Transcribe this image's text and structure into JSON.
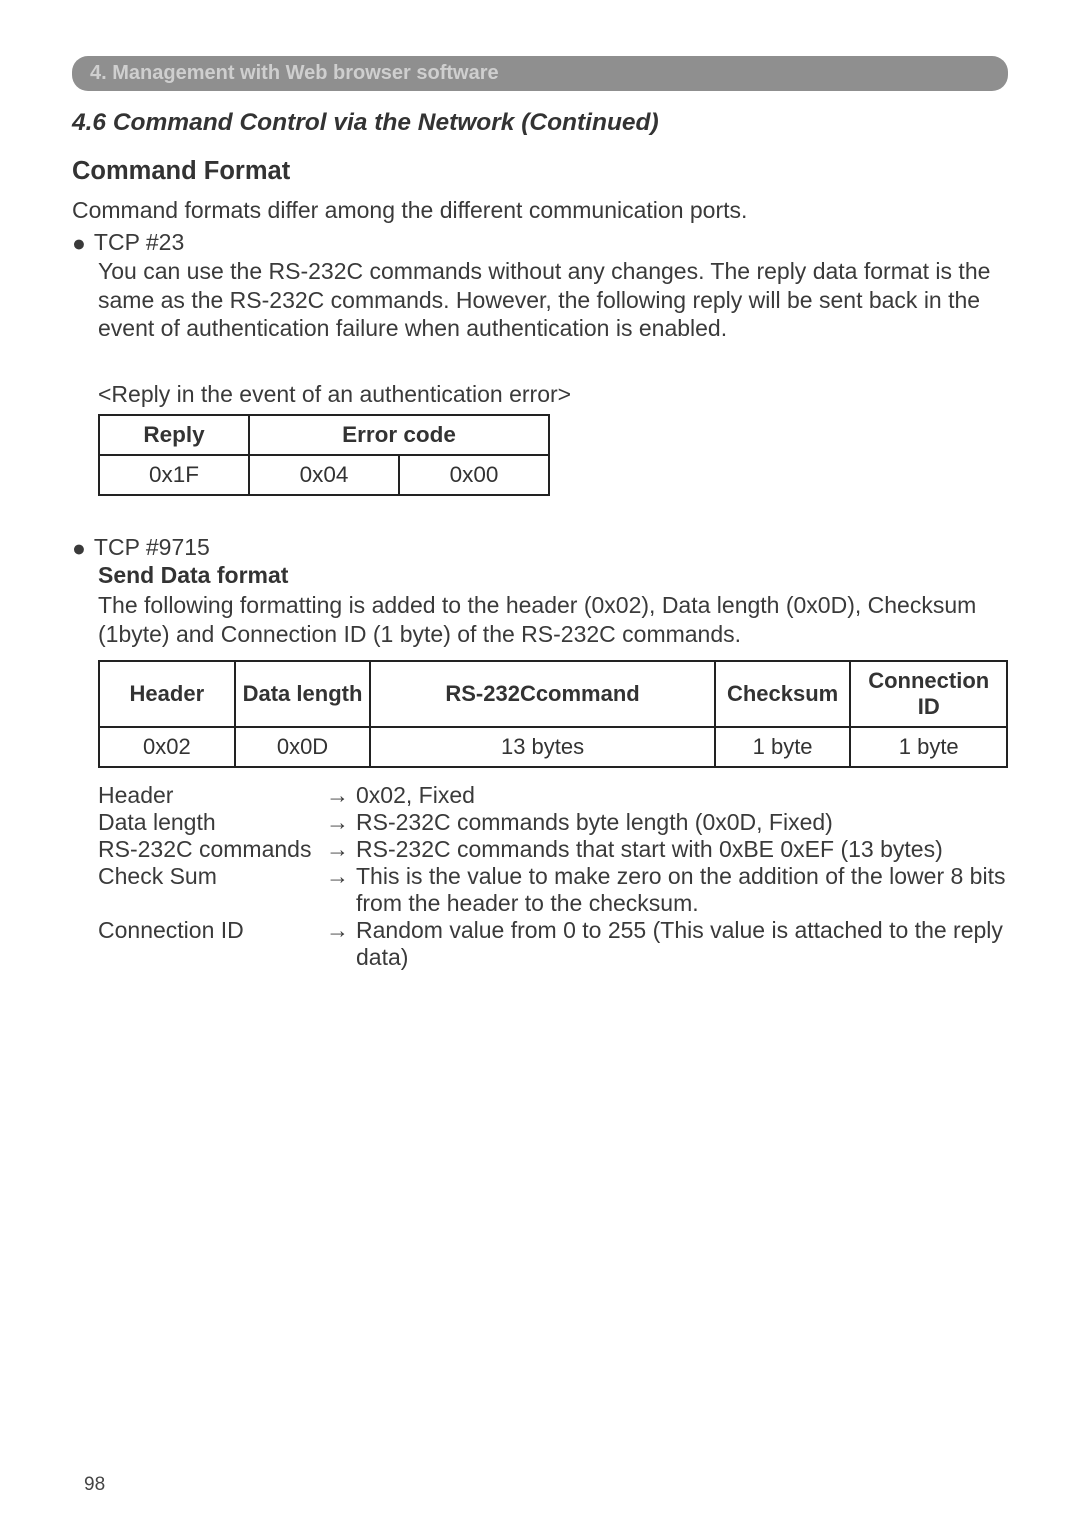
{
  "banner": "4. Management with Web browser software",
  "section_title": "4.6 Command Control via the Network (Continued)",
  "command_format_heading": "Command Format",
  "intro": "Command formats differ among the different communication ports.",
  "tcp23": {
    "label": "TCP #23",
    "p1": "You can use the RS-232C commands without any changes. The reply data format is the same as the RS-232C commands. However, the following reply will be sent back in the event of authentication failure when authentication is enabled.",
    "caption": "<Reply in the event of an authentication error>",
    "table": {
      "h1": "Reply",
      "h2": "Error code",
      "c1": "0x1F",
      "c2": "0x04",
      "c3": "0x00"
    }
  },
  "tcp9715": {
    "label": "TCP #9715",
    "send_heading": "Send Data format",
    "p1": "The following formatting is added to the header (0x02), Data length (0x0D), Checksum (1byte) and Connection ID (1 byte) of the RS-232C commands.",
    "table": {
      "h1": "Header",
      "h2": "Data length",
      "h3": "RS-232Ccommand",
      "h4": "Checksum",
      "h5": "Connection ID",
      "c1": "0x02",
      "c2": "0x0D",
      "c3": "13 bytes",
      "c4": "1 byte",
      "c5": "1 byte"
    },
    "defs": [
      {
        "term": "Header",
        "desc": "0x02, Fixed"
      },
      {
        "term": "Data length",
        "desc": "RS-232C commands byte length (0x0D, Fixed)"
      },
      {
        "term": "RS-232C commands",
        "desc": "RS-232C commands that start with 0xBE 0xEF (13 bytes)"
      },
      {
        "term": "Check Sum",
        "desc": "This is the value to make zero on the addition of the lower 8 bits from the header to the checksum."
      },
      {
        "term": "Connection ID",
        "desc": "Random value from 0 to 255 (This value is attached to the reply data)"
      }
    ],
    "arrow": "→"
  },
  "page_number": "98"
}
